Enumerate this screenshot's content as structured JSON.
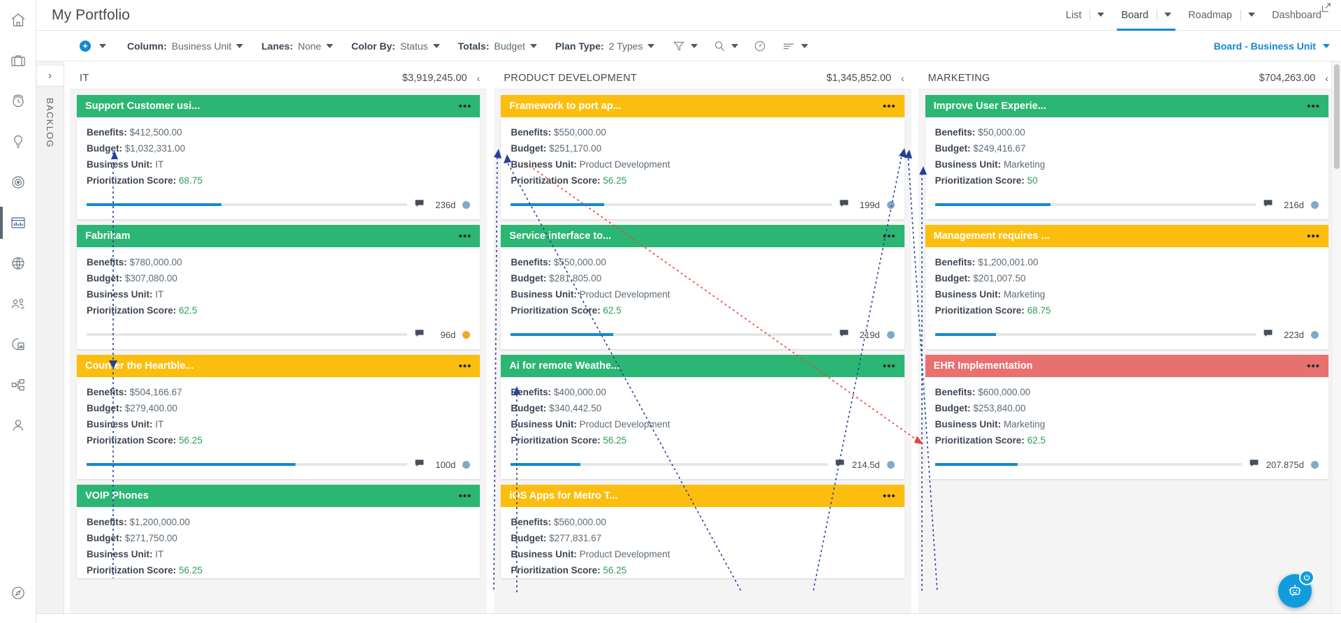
{
  "app": {
    "page_title": "My Portfolio"
  },
  "rail": {
    "items": [
      {
        "name": "home-icon",
        "label": "Home"
      },
      {
        "name": "briefcase-icon",
        "label": "Portfolios"
      },
      {
        "name": "clock-history-icon",
        "label": "Timesheets"
      },
      {
        "name": "lightbulb-icon",
        "label": "Ideas"
      },
      {
        "name": "target-icon",
        "label": "Goals"
      },
      {
        "name": "bar-chart-icon",
        "label": "Plans",
        "active": true
      },
      {
        "name": "globe-icon",
        "label": "Global"
      },
      {
        "name": "people-icon",
        "label": "Resources"
      },
      {
        "name": "analytics-report-icon",
        "label": "Reports"
      },
      {
        "name": "hierarchy-icon",
        "label": "Structure"
      },
      {
        "name": "person-icon",
        "label": "Profile"
      }
    ],
    "bottom": {
      "name": "compass-icon",
      "label": "Explore"
    }
  },
  "view_tabs": [
    {
      "label": "List",
      "active": false,
      "has_caret": true
    },
    {
      "label": "Board",
      "active": true,
      "has_caret": true
    },
    {
      "label": "Roadmap",
      "active": false,
      "has_caret": true
    },
    {
      "label": "Dashboard",
      "active": false,
      "has_caret": false
    }
  ],
  "toolbar": {
    "add_label": "+",
    "filters": [
      {
        "label": "Column:",
        "value": "Business Unit"
      },
      {
        "label": "Lanes:",
        "value": "None"
      },
      {
        "label": "Color By:",
        "value": "Status"
      },
      {
        "label": "Totals:",
        "value": "Budget"
      },
      {
        "label": "Plan Type:",
        "value": "2 Types"
      }
    ],
    "icons": [
      {
        "name": "filter-icon",
        "caret": true
      },
      {
        "name": "search-icon",
        "caret": true
      },
      {
        "name": "gauge-icon",
        "caret": false
      },
      {
        "name": "sort-lines-icon",
        "caret": true
      }
    ],
    "board_selector": "Board - Business Unit"
  },
  "backlog": {
    "label": "BACKLOG",
    "toggle": "›"
  },
  "colors": {
    "green": "#2cb673",
    "amber": "#fcbe0e",
    "red": "#e8706f",
    "accent_blue": "#1189d4",
    "score_green": "#2e9e54",
    "dot_blue": "#7eaac8",
    "dot_orange": "#f0a81e"
  },
  "labels": {
    "benefits": "Benefits:",
    "budget": "Budget:",
    "business_unit": "Business Unit:",
    "prioritization_score": "Prioritization Score:",
    "collapse": "‹",
    "menu": "•••",
    "comment_icon": "comment-icon"
  },
  "columns": [
    {
      "name": "IT",
      "total": "$3,919,245.00",
      "cards": [
        {
          "title": "Support Customer usi...",
          "status_color": "green",
          "benefits": "$412,500.00",
          "budget": "$1,032,331.00",
          "business_unit": "IT",
          "score": "68.75",
          "progress": 42,
          "days": "236d",
          "dot": "dot_blue"
        },
        {
          "title": "Fabrikam",
          "status_color": "green",
          "benefits": "$780,000.00",
          "budget": "$307,080.00",
          "business_unit": "IT",
          "score": "62.5",
          "progress": 0,
          "days": "96d",
          "dot": "dot_orange"
        },
        {
          "title": "Counter the Heartble...",
          "status_color": "amber",
          "benefits": "$504,166.67",
          "budget": "$279,400.00",
          "business_unit": "IT",
          "score": "56.25",
          "progress": 65,
          "days": "100d",
          "dot": "dot_blue"
        },
        {
          "title": "VOIP Phones",
          "status_color": "green",
          "benefits": "$1,200,000.00",
          "budget": "$271,750.00",
          "business_unit": "IT",
          "score": "56.25",
          "progress": 0,
          "days": "",
          "dot": "dot_blue",
          "clipped": true
        }
      ]
    },
    {
      "name": "PRODUCT DEVELOPMENT",
      "total": "$1,345,852.00",
      "cards": [
        {
          "title": "Framework to port ap...",
          "status_color": "amber",
          "benefits": "$550,000.00",
          "budget": "$251,170.00",
          "business_unit": "Product Development",
          "score": "56.25",
          "progress": 29,
          "days": "199d",
          "dot": "dot_blue"
        },
        {
          "title": "Service interface to...",
          "status_color": "green",
          "benefits": "$550,000.00",
          "budget": "$281,805.00",
          "business_unit": "Product Development",
          "score": "62.5",
          "progress": 32,
          "days": "219d",
          "dot": "dot_blue"
        },
        {
          "title": "Ai for remote Weathe...",
          "status_color": "green",
          "benefits": "$400,000.00",
          "budget": "$340,442.50",
          "business_unit": "Product Development",
          "score": "56.25",
          "progress": 22,
          "days": "214.5d",
          "dot": "dot_blue"
        },
        {
          "title": "iOS Apps for Metro T...",
          "status_color": "amber",
          "benefits": "$560,000.00",
          "budget": "$277,831.67",
          "business_unit": "Product Development",
          "score": "56.25",
          "progress": 0,
          "days": "",
          "dot": "dot_blue",
          "clipped": true
        }
      ]
    },
    {
      "name": "MARKETING",
      "total": "$704,263.00",
      "cards": [
        {
          "title": "Improve User Experie...",
          "status_color": "green",
          "benefits": "$50,000.00",
          "budget": "$249,416.67",
          "business_unit": "Marketing",
          "score": "50",
          "progress": 36,
          "days": "216d",
          "dot": "dot_blue"
        },
        {
          "title": "Management requires ...",
          "status_color": "amber",
          "benefits": "$1,200,001.00",
          "budget": "$201,007.50",
          "business_unit": "Marketing",
          "score": "68.75",
          "progress": 19,
          "days": "223d",
          "dot": "dot_blue"
        },
        {
          "title": "EHR Implementation",
          "status_color": "red",
          "benefits": "$600,000.00",
          "budget": "$253,840.00",
          "business_unit": "Marketing",
          "score": "62.5",
          "progress": 27,
          "days": "207.875d",
          "dot": "dot_blue"
        }
      ]
    }
  ],
  "fab": {
    "name": "chatbot-icon",
    "badge": "power-icon"
  }
}
